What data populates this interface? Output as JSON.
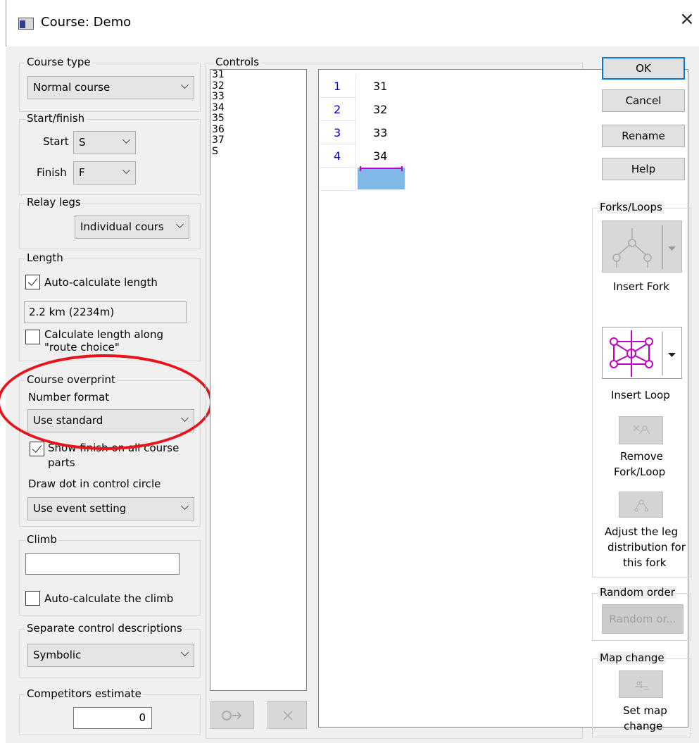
{
  "window": {
    "title": "Course: Demo",
    "close_glyph": "×"
  },
  "course_type": {
    "legend": "Course type",
    "value": "Normal course"
  },
  "start_finish": {
    "legend": "Start/finish",
    "start_label": "Start",
    "start_value": "S",
    "finish_label": "Finish",
    "finish_value": "F"
  },
  "relay_legs": {
    "legend": "Relay legs",
    "value": "Individual cours"
  },
  "length": {
    "legend": "Length",
    "auto_calc_label": "Auto-calculate length",
    "auto_calc_checked": true,
    "value": "2.2 km (2234m)",
    "route_choice_label_1": "Calculate length along",
    "route_choice_label_2": "\"route choice\"",
    "route_choice_checked": false
  },
  "course_overprint": {
    "legend": "Course overprint",
    "number_format_label": "Number format",
    "number_format_value": "Use standard",
    "show_finish_label_1": "Show finish on all course",
    "show_finish_label_2": "parts",
    "show_finish_checked": true,
    "draw_dot_label": "Draw dot in control circle",
    "draw_dot_value": "Use event setting"
  },
  "climb": {
    "legend": "Climb",
    "value": "",
    "auto_calc_label": "Auto-calculate the climb",
    "auto_calc_checked": false
  },
  "control_descriptions": {
    "legend": "Separate control descriptions",
    "value": "Symbolic"
  },
  "competitors": {
    "legend": "Competitors estimate",
    "value": "0"
  },
  "controls": {
    "legend": "Controls",
    "items": [
      "31",
      "32",
      "33",
      "34",
      "35",
      "36",
      "37",
      "S"
    ]
  },
  "sequence": [
    {
      "num": "1",
      "code": "31"
    },
    {
      "num": "2",
      "code": "32"
    },
    {
      "num": "3",
      "code": "33"
    },
    {
      "num": "4",
      "code": "34"
    }
  ],
  "buttons": {
    "ok": "OK",
    "cancel": "Cancel",
    "rename": "Rename",
    "help": "Help"
  },
  "forks_loops": {
    "legend": "Forks/Loops",
    "insert_fork": "Insert Fork",
    "insert_loop": "Insert Loop",
    "remove_1": "Remove",
    "remove_2": "Fork/Loop",
    "adjust_1": "Adjust the leg",
    "adjust_2": "distribution for",
    "adjust_3": "this fork"
  },
  "random_order": {
    "legend": "Random order",
    "button": "Random or..."
  },
  "map_change": {
    "legend": "Map change",
    "label_1": "Set map",
    "label_2": "change"
  },
  "colors": {
    "accent": "#0078d7",
    "loop_icon": "#c000c0",
    "selection": "#80b8e8",
    "annotation": "#e8141b"
  }
}
